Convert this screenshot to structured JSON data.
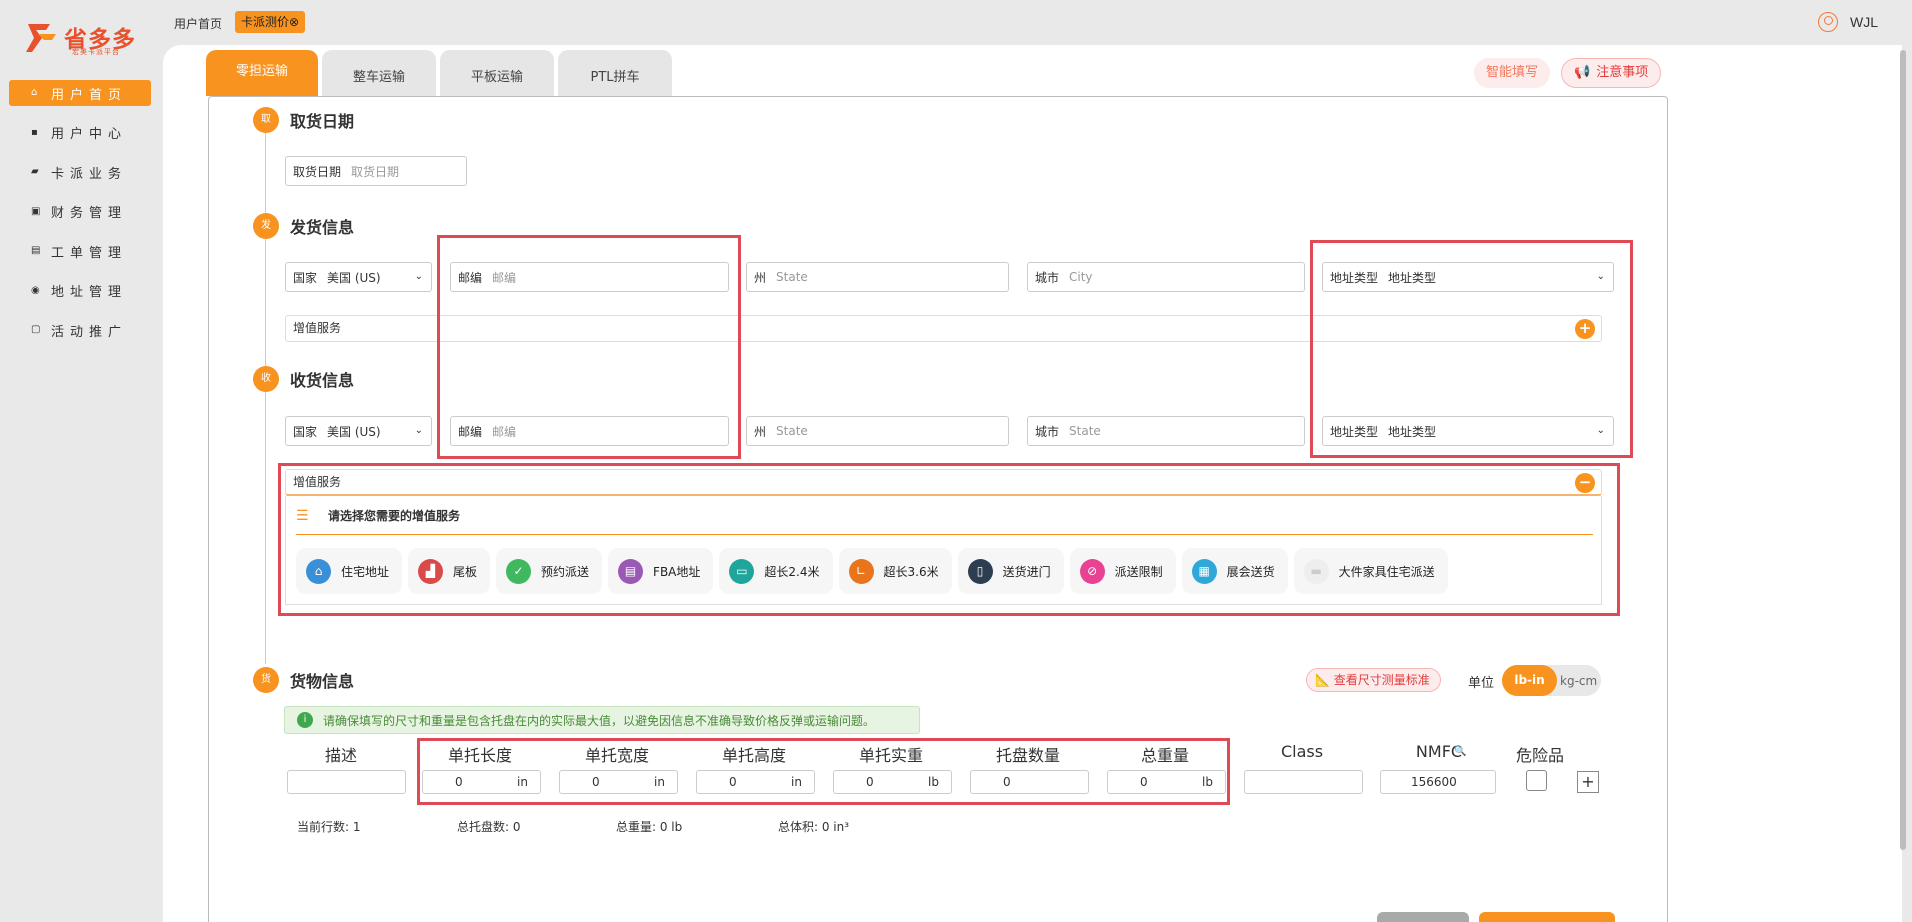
{
  "brand": {
    "logo_text": "省多多",
    "logo_sub": "宏美卡派平台",
    "accent": "#f7931e"
  },
  "topbar": {
    "home_link": "用户首页",
    "active_tag": "卡派测价",
    "tag_close_icon": "close-circle-icon",
    "username": "WJL"
  },
  "sidebar": {
    "items": [
      {
        "label": "用户首页",
        "icon": "home-icon",
        "active": true
      },
      {
        "label": "用户中心",
        "icon": "grid-icon",
        "active": false
      },
      {
        "label": "卡派业务",
        "icon": "truck-icon",
        "active": false
      },
      {
        "label": "财务管理",
        "icon": "wallet-icon",
        "active": false
      },
      {
        "label": "工单管理",
        "icon": "ticket-icon",
        "active": false
      },
      {
        "label": "地址管理",
        "icon": "location-icon",
        "active": false
      },
      {
        "label": "活动推广",
        "icon": "gift-icon",
        "active": false
      }
    ]
  },
  "tabs": [
    {
      "label": "零担运输",
      "active": true
    },
    {
      "label": "整车运输",
      "active": false
    },
    {
      "label": "平板运输",
      "active": false
    },
    {
      "label": "PTL拼车",
      "active": false
    }
  ],
  "actions": {
    "smart_fill": "智能填写",
    "notice": "注意事项"
  },
  "pickup": {
    "badge": "取",
    "title": "取货日期",
    "date_label": "取货日期",
    "date_placeholder": "取货日期"
  },
  "shipper": {
    "badge": "发",
    "title": "发货信息",
    "country_label": "国家",
    "country_value": "美国 (US)",
    "zip_label": "邮编",
    "zip_placeholder": "邮编",
    "state_label": "州",
    "state_placeholder": "State",
    "city_label": "城市",
    "city_placeholder": "City",
    "addr_type_label": "地址类型",
    "addr_type_value": "地址类型",
    "vas_label": "增值服务",
    "vas_toggle": "+"
  },
  "receiver": {
    "badge": "收",
    "title": "收货信息",
    "country_label": "国家",
    "country_value": "美国 (US)",
    "zip_label": "邮编",
    "zip_placeholder": "邮编",
    "state_label": "州",
    "state_placeholder": "State",
    "city_label": "城市",
    "city_placeholder": "State",
    "addr_type_label": "地址类型",
    "addr_type_value": "地址类型",
    "vas_label": "增值服务",
    "vas_toggle": "−",
    "vas_prompt": "请选择您需要的增值服务",
    "services": [
      {
        "label": "住宅地址",
        "icon": "house-icon",
        "color": "#3a8fd9"
      },
      {
        "label": "尾板",
        "icon": "liftgate-icon",
        "color": "#d94a4a"
      },
      {
        "label": "预约派送",
        "icon": "calendar-check-icon",
        "color": "#3fb85f"
      },
      {
        "label": "FBA地址",
        "icon": "warehouse-icon",
        "color": "#9b59b6"
      },
      {
        "label": "超长2.4米",
        "icon": "ruler-icon",
        "color": "#1fa59a"
      },
      {
        "label": "超长3.6米",
        "icon": "ruler-corner-icon",
        "color": "#e8741c"
      },
      {
        "label": "送货进门",
        "icon": "door-icon",
        "color": "#2c3e50"
      },
      {
        "label": "派送限制",
        "icon": "ban-icon",
        "color": "#e84393"
      },
      {
        "label": "展会送货",
        "icon": "calendar-icon",
        "color": "#2fa8d8"
      },
      {
        "label": "大件家具住宅派送",
        "icon": "sofa-icon",
        "color": "#e0e0e0"
      }
    ]
  },
  "cargo": {
    "badge": "货",
    "title": "货物信息",
    "size_ref": "查看尺寸测量标准",
    "unit_label": "单位",
    "unit_on": "lb-in",
    "unit_off": "kg-cm",
    "alert": "请确保填写的尺寸和重量是包含托盘在内的实际最大值，以避免因信息不准确导致价格反弹或运输问题。",
    "columns": [
      "描述",
      "单托长度",
      "单托宽度",
      "单托高度",
      "单托实重",
      "托盘数量",
      "总重量",
      "Class",
      "NMFC",
      "危险品"
    ],
    "row": {
      "description": "",
      "length": "0",
      "length_unit": "in",
      "width": "0",
      "width_unit": "in",
      "height": "0",
      "height_unit": "in",
      "weight": "0",
      "weight_unit": "lb",
      "pallets": "0",
      "total_weight": "0",
      "total_weight_unit": "lb",
      "class": "",
      "nmfc": "156600"
    },
    "add_row": "+",
    "stats": {
      "rows": "当前行数: 1",
      "pallets": "总托盘数: 0",
      "weight": "总重量: 0 lb",
      "volume": "总体积: 0 in³"
    }
  }
}
